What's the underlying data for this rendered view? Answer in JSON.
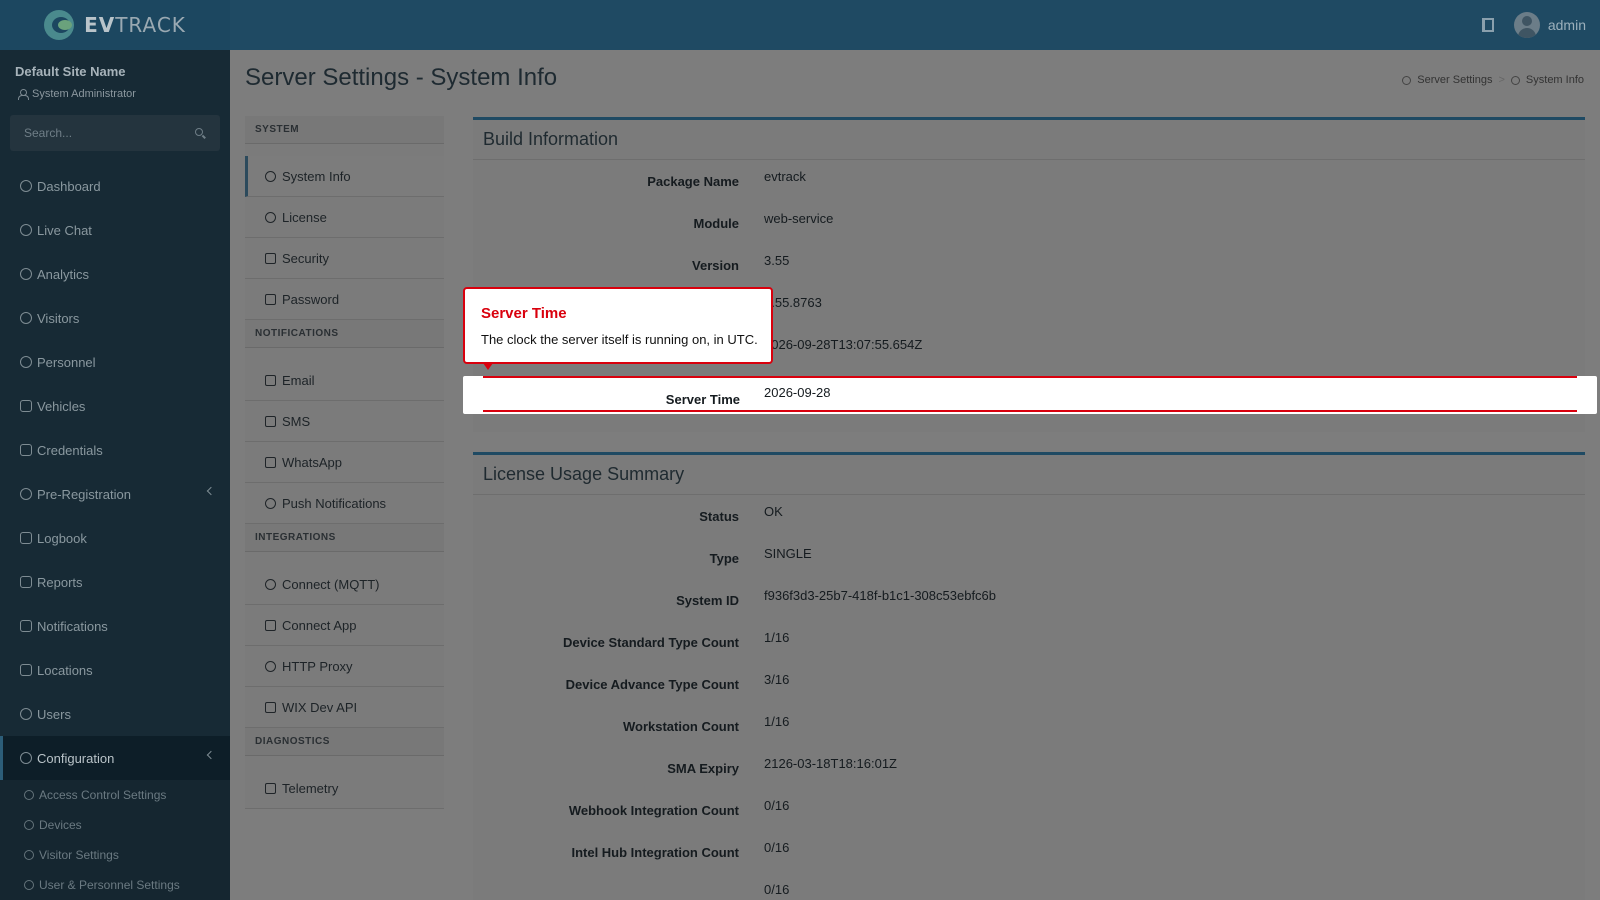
{
  "brand": {
    "prefix": "EV",
    "suffix": "TRACK"
  },
  "topbar": {
    "user_name": "admin"
  },
  "sidebar": {
    "site_name": "Default Site Name",
    "role": "System Administrator",
    "search_placeholder": "Search...",
    "items": [
      {
        "label": "Dashboard"
      },
      {
        "label": "Live Chat"
      },
      {
        "label": "Analytics"
      },
      {
        "label": "Visitors"
      },
      {
        "label": "Personnel"
      },
      {
        "label": "Vehicles"
      },
      {
        "label": "Credentials"
      },
      {
        "label": "Pre-Registration"
      },
      {
        "label": "Logbook"
      },
      {
        "label": "Reports"
      },
      {
        "label": "Notifications"
      },
      {
        "label": "Locations"
      },
      {
        "label": "Users"
      },
      {
        "label": "Configuration"
      }
    ],
    "sub_items": [
      {
        "label": "Access Control Settings"
      },
      {
        "label": "Devices"
      },
      {
        "label": "Visitor Settings"
      },
      {
        "label": "User & Personnel Settings"
      }
    ]
  },
  "page": {
    "title": "Server Settings - System Info",
    "breadcrumb": {
      "parent": "Server Settings",
      "separator": ">",
      "current": "System Info"
    }
  },
  "settings_menu": {
    "system_header": "SYSTEM",
    "system_items": [
      "System Info",
      "License",
      "Security",
      "Password"
    ],
    "notifications_header": "NOTIFICATIONS",
    "notifications_items": [
      "Email",
      "SMS",
      "WhatsApp",
      "Push Notifications"
    ],
    "integrations_header": "INTEGRATIONS",
    "integrations_items": [
      "Connect (MQTT)",
      "Connect App",
      "HTTP Proxy",
      "WIX Dev API"
    ],
    "diagnostics_header": "DIAGNOSTICS",
    "diagnostics_items": [
      "Telemetry"
    ]
  },
  "build_info": {
    "title": "Build Information",
    "rows": [
      {
        "key": "Package Name",
        "value": "evtrack"
      },
      {
        "key": "Module",
        "value": "web-service"
      },
      {
        "key": "Version",
        "value": "3.55"
      },
      {
        "key": "",
        "value": "3.55.8763"
      },
      {
        "key": "",
        "value": "2026-09-28T13:07:55.654Z"
      }
    ],
    "highlight_row": {
      "key": "Server Time",
      "value": "2026-09-28"
    }
  },
  "tooltip": {
    "title": "Server Time",
    "body": "The clock the server itself is running on, in UTC."
  },
  "license_summary": {
    "title": "License Usage Summary",
    "rows": [
      {
        "key": "Status",
        "value": "OK"
      },
      {
        "key": "Type",
        "value": "SINGLE"
      },
      {
        "key": "System ID",
        "value": "f936f3d3-25b7-418f-b1c1-308c53ebfc6b"
      },
      {
        "key": "Device Standard Type Count",
        "value": "1/16"
      },
      {
        "key": "Device Advance Type Count",
        "value": "3/16"
      },
      {
        "key": "Workstation Count",
        "value": "1/16"
      },
      {
        "key": "SMA Expiry",
        "value": "2126-03-18T18:16:01Z"
      },
      {
        "key": "Webhook Integration Count",
        "value": "0/16"
      },
      {
        "key": "Intel Hub Integration Count",
        "value": "0/16"
      },
      {
        "key": "",
        "value": "0/16"
      }
    ]
  },
  "colors": {
    "accent": "#1f4a63",
    "highlight": "#d9000d",
    "overlay_bg": "#7b7b7b"
  }
}
